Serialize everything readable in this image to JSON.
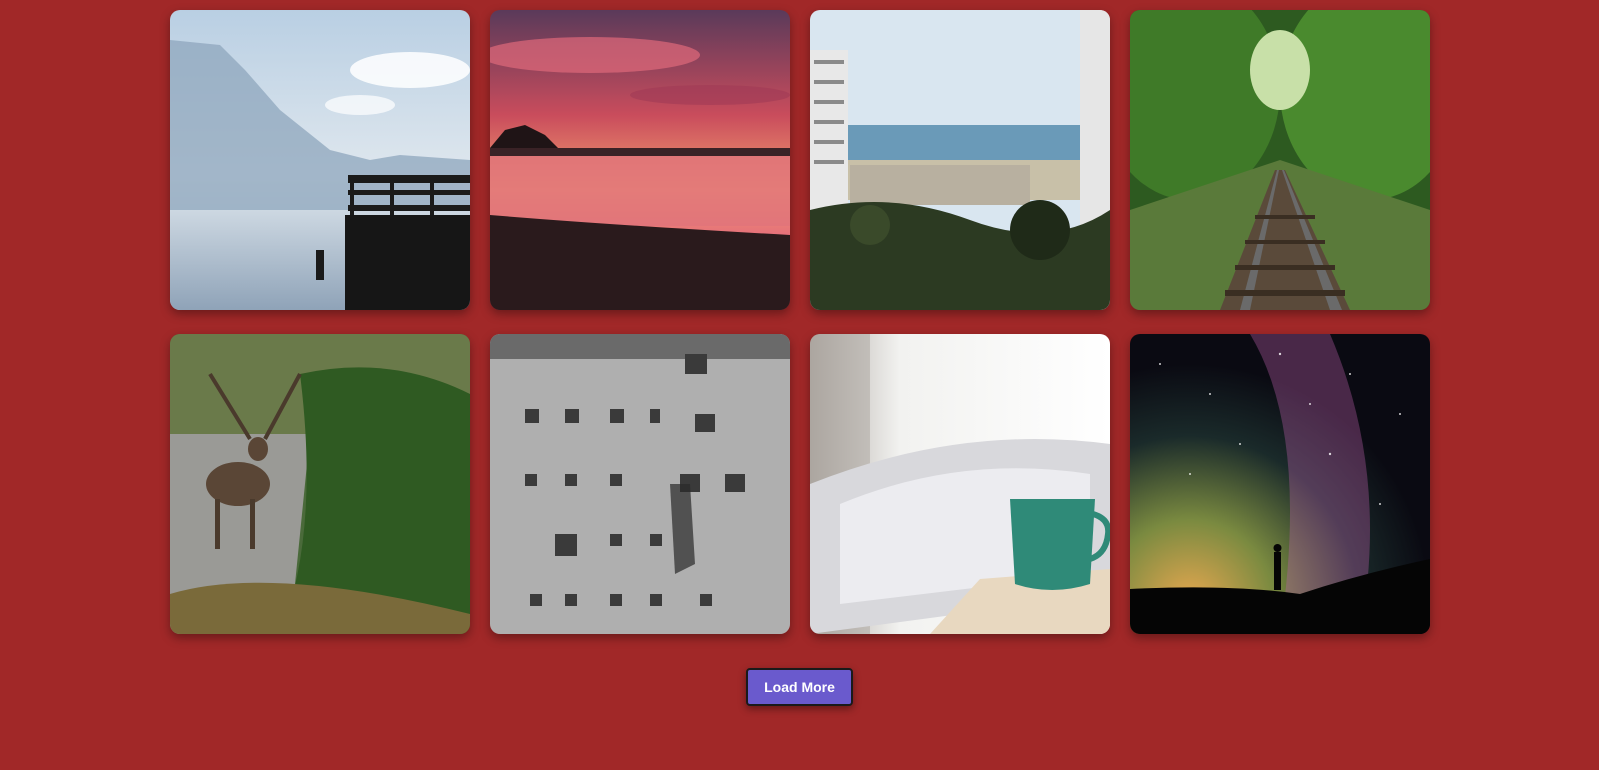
{
  "gallery": {
    "photos": [
      {
        "subject": "lake-pier"
      },
      {
        "subject": "sunset-beach"
      },
      {
        "subject": "city-coast"
      },
      {
        "subject": "forest-railway"
      },
      {
        "subject": "deer-river"
      },
      {
        "subject": "old-building"
      },
      {
        "subject": "coffee-cup-bed"
      },
      {
        "subject": "milky-way"
      }
    ]
  },
  "load_more": {
    "label": "Load More"
  },
  "colors": {
    "background": "#a12828",
    "button": "#6a5acd",
    "button_text": "#ffffff"
  }
}
